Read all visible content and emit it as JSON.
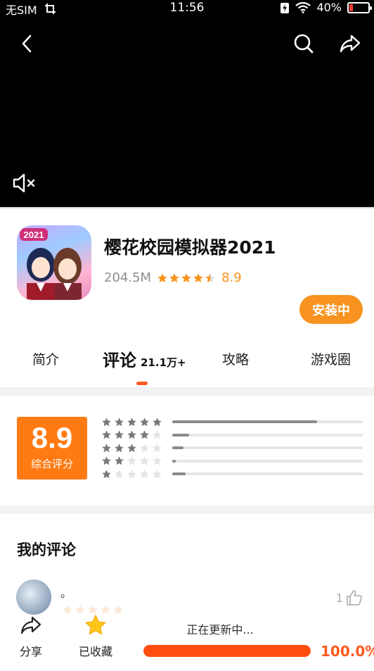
{
  "status_bar": {
    "carrier": "无SIM",
    "time": "11:56",
    "battery": "40%"
  },
  "video": {
    "back_icon": "chevron-left-icon",
    "search_icon": "search-icon",
    "share_icon": "share-icon",
    "mute_icon": "volume-mute-icon"
  },
  "app": {
    "title": "樱花校园模拟器2021",
    "size": "204.5M",
    "rating": "8.9",
    "install_label": "安装中",
    "icon_badge": "2021"
  },
  "tabs": [
    {
      "label": "简介"
    },
    {
      "label": "评论",
      "count": "21.1万+"
    },
    {
      "label": "攻略"
    },
    {
      "label": "游戏圈"
    }
  ],
  "rating_summary": {
    "score": "8.9",
    "label": "综合评分",
    "distribution": [
      0.76,
      0.09,
      0.06,
      0.02,
      0.07
    ]
  },
  "my_review": {
    "title": "我的评论",
    "text": "。",
    "likes": "1"
  },
  "bottom_bar": {
    "share_label": "分享",
    "favorite_label": "已收藏",
    "update_text": "正在更新中...",
    "progress_text": "100.0%",
    "progress": 1.0
  },
  "colors": {
    "accent": "#f7931e",
    "progress": "#ff4d0f",
    "score_box": "#ff7a12"
  }
}
